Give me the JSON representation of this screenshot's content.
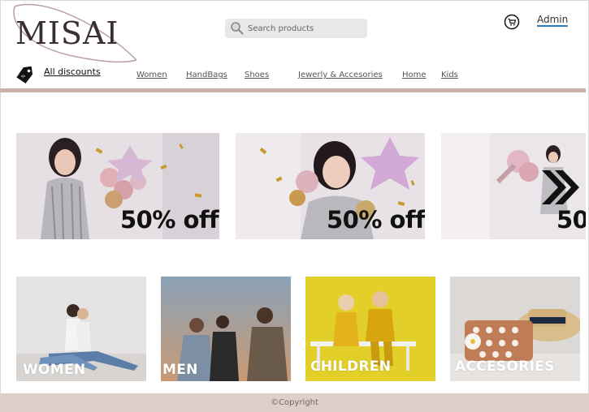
{
  "brand": {
    "logo_text": "MISAI"
  },
  "search": {
    "placeholder": "Search products"
  },
  "header": {
    "admin_label": "Admin"
  },
  "discounts": {
    "label": "All discounts"
  },
  "nav": {
    "items": [
      "Women",
      "HandBags",
      "Shoes",
      "Jewerly  & Accesories",
      "Home",
      "Kids"
    ]
  },
  "promos": [
    {
      "offer": "50% off"
    },
    {
      "offer": "50% off"
    },
    {
      "offer": "50"
    }
  ],
  "categories": [
    {
      "label": "WOMEN"
    },
    {
      "label": "MEN"
    },
    {
      "label": "CHILDREN"
    },
    {
      "label": "ACCESORIES"
    }
  ],
  "footer": {
    "copyright": "©Copyright"
  },
  "icons": {
    "search": "search-icon",
    "cart": "cart-icon",
    "tag": "discount-tag-icon",
    "next": "chevron-double-right-icon"
  },
  "colors": {
    "divider": "#c9b2a8",
    "footer": "#e0cec8",
    "admin_underline": "#2e7db8"
  }
}
